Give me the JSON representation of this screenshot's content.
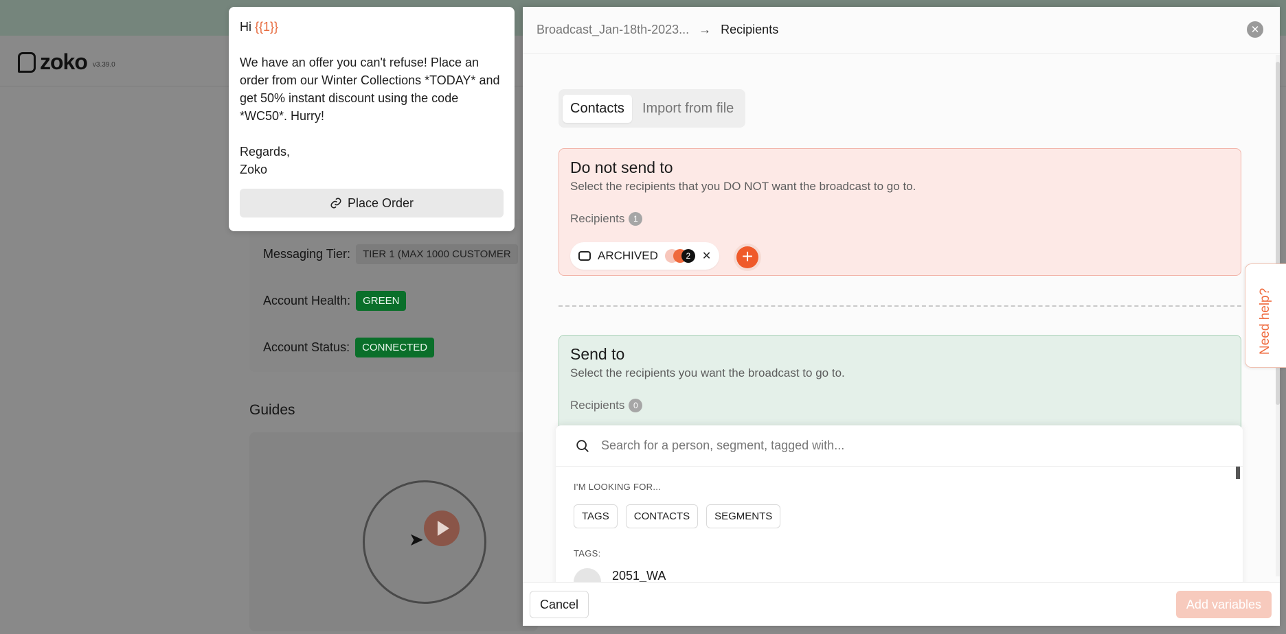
{
  "app": {
    "name": "zoko",
    "version": "v3.39.0"
  },
  "background": {
    "messaging_tier_label": "Messaging Tier:",
    "messaging_tier_value": "TIER 1 (MAX 1000 CUSTOMER",
    "account_health_label": "Account Health:",
    "account_health_value": "GREEN",
    "account_status_label": "Account Status:",
    "account_status_value": "CONNECTED",
    "guides_title": "Guides",
    "colors": {
      "status_green": "#0a6f2a"
    }
  },
  "preview": {
    "greeting": "Hi ",
    "variable": "{{1}}",
    "body": "We have an offer you can't refuse! Place an order from our Winter Collections  *TODAY* and get 50% instant discount using the code *WC50*. Hurry!",
    "regards": "Regards,",
    "signature": "Zoko",
    "button_label": "Place Order",
    "button_icon": "link-icon"
  },
  "drawer": {
    "breadcrumb": {
      "parent": "Broadcast_Jan-18th-2023...",
      "current": "Recipients"
    },
    "tabs": [
      {
        "label": "Contacts",
        "active": true
      },
      {
        "label": "Import from file",
        "active": false
      }
    ],
    "do_not_send": {
      "title": "Do not send to",
      "description": "Select the recipients that you DO NOT want the broadcast to go to.",
      "recipients_label": "Recipients",
      "recipients_count": "1",
      "chip": {
        "label": "ARCHIVED",
        "avatar_count": "2"
      }
    },
    "send_to": {
      "title": "Send to",
      "description": "Select the recipients you want the broadcast to go to.",
      "recipients_label": "Recipients",
      "recipients_count": "0"
    },
    "dropdown": {
      "search_placeholder": "Search for a person, segment, tagged with...",
      "looking_for_label": "I'M LOOKING FOR...",
      "filters": [
        "TAGS",
        "CONTACTS",
        "SEGMENTS"
      ],
      "tags_label": "TAGS:",
      "first_item": "2051_WA"
    },
    "footer": {
      "cancel_label": "Cancel",
      "add_variables_label": "Add variables"
    }
  },
  "help": {
    "label": "Need help?"
  },
  "colors": {
    "accent": "#ef5a2a",
    "danger_bg": "#fde9e6",
    "success_bg": "#e4f0e9"
  }
}
